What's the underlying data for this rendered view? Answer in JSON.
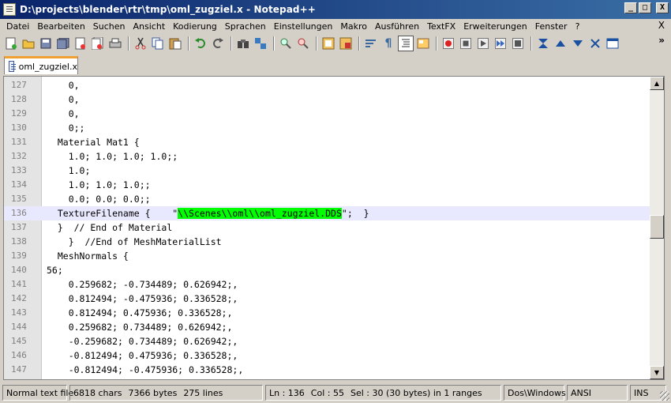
{
  "window": {
    "title": "D:\\projects\\blender\\rtr\\tmp\\oml_zugziel.x - Notepad++",
    "buttons": {
      "minimize": "_",
      "maximize": "□",
      "close": "X"
    }
  },
  "menu": {
    "items": [
      "Datei",
      "Bearbeiten",
      "Suchen",
      "Ansicht",
      "Kodierung",
      "Sprachen",
      "Einstellungen",
      "Makro",
      "Ausführen",
      "TextFX",
      "Erweiterungen",
      "Fenster",
      "?"
    ],
    "close": "X"
  },
  "toolbar": {
    "more": "»"
  },
  "tabs": [
    {
      "label": "oml_zugziel.x"
    }
  ],
  "editor": {
    "current_line_index": 9,
    "highlight_color": "#00ff00",
    "current_line_color": "#e8e8ff",
    "lines": [
      {
        "num": "127",
        "text": "    0,"
      },
      {
        "num": "128",
        "text": "    0,"
      },
      {
        "num": "129",
        "text": "    0,"
      },
      {
        "num": "130",
        "text": "    0;;"
      },
      {
        "num": "131",
        "text": "  Material Mat1 {"
      },
      {
        "num": "132",
        "text": "    1.0; 1.0; 1.0; 1.0;;"
      },
      {
        "num": "133",
        "text": "    1.0;"
      },
      {
        "num": "134",
        "text": "    1.0; 1.0; 1.0;;"
      },
      {
        "num": "135",
        "text": "    0.0; 0.0; 0.0;;"
      },
      {
        "num": "136",
        "pre": "  TextureFilename {    \"",
        "hl": "\\\\Scenes\\\\oml\\\\oml_zugziel.DDS",
        "post": "\";  }"
      },
      {
        "num": "137",
        "text": "  }  // End of Material"
      },
      {
        "num": "138",
        "text": "    }  //End of MeshMaterialList"
      },
      {
        "num": "139",
        "text": "  MeshNormals {"
      },
      {
        "num": "140",
        "text": "56;"
      },
      {
        "num": "141",
        "text": "    0.259682; -0.734489; 0.626942;,"
      },
      {
        "num": "142",
        "text": "    0.812494; -0.475936; 0.336528;,"
      },
      {
        "num": "143",
        "text": "    0.812494; 0.475936; 0.336528;,"
      },
      {
        "num": "144",
        "text": "    0.259682; 0.734489; 0.626942;,"
      },
      {
        "num": "145",
        "text": "    -0.259682; 0.734489; 0.626942;,"
      },
      {
        "num": "146",
        "text": "    -0.812494; 0.475936; 0.336528;,"
      },
      {
        "num": "147",
        "text": "    -0.812494; -0.475936; 0.336528;,"
      }
    ]
  },
  "statusbar": {
    "type": "Normal text file",
    "chars": "6818 chars",
    "bytes": "7366 bytes",
    "lines": "275 lines",
    "ln": "Ln : 136",
    "col": "Col : 55",
    "sel": "Sel : 30 (30 bytes) in 1 ranges",
    "eol": "Dos\\Windows",
    "encoding": "ANSI",
    "mode": "INS"
  }
}
